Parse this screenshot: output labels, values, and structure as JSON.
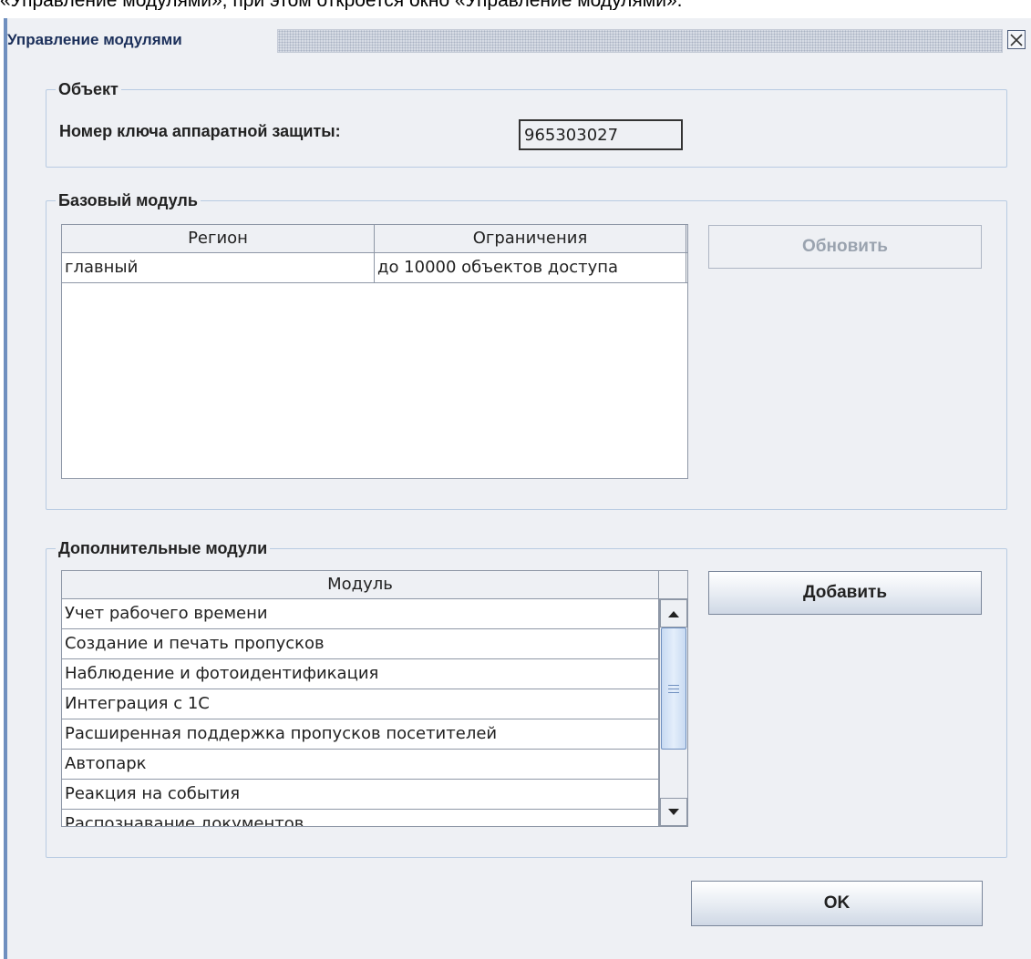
{
  "page": {
    "caption": "«Управление модулями», при этом откроется окно «Управление модулями»."
  },
  "window": {
    "title": "Управление модулями",
    "close_icon": "close-x-icon"
  },
  "object_group": {
    "legend": "Объект",
    "key_label": "Номер ключа аппаратной защиты:",
    "key_value": "965303027"
  },
  "base_group": {
    "legend": "Базовый модуль",
    "columns": [
      "Регион",
      "Ограничения"
    ],
    "rows": [
      [
        "главный",
        "до 10000 объектов доступа"
      ]
    ],
    "update_label": "Обновить"
  },
  "extra_group": {
    "legend": "Дополнительные модули",
    "column": "Модуль",
    "rows": [
      "Учет рабочего времени",
      "Создание и печать пропусков",
      "Наблюдение и фотоидентификация",
      "Интеграция с 1С",
      "Расширенная поддержка пропусков посетителей",
      "Автопарк",
      "Реакция на события",
      "Распознавание документов"
    ],
    "add_label": "Добавить"
  },
  "footer": {
    "ok_label": "OK"
  },
  "colors": {
    "window_bg": "#eef0f4",
    "border_accent": "#6f8fbf",
    "group_border": "#b8cbe2",
    "disabled_text": "#9aa3af"
  }
}
